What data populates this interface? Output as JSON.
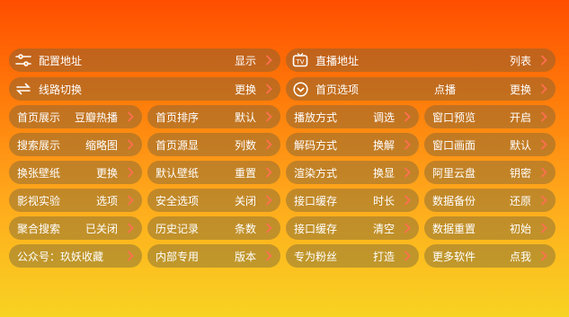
{
  "top_rows": {
    "config_address": {
      "label": "配置地址",
      "value": "显示"
    },
    "live_address": {
      "label": "直播地址",
      "value": "列表"
    },
    "route_switch": {
      "label": "线路切换",
      "value": "更换"
    },
    "home_options": {
      "label": "首页选项",
      "center": "点播",
      "value": "更换"
    }
  },
  "grid": [
    [
      {
        "label": "首页展示",
        "value": "豆瓣热播"
      },
      {
        "label": "首页排序",
        "value": "默认"
      },
      {
        "label": "播放方式",
        "value": "调选"
      },
      {
        "label": "窗口预览",
        "value": "开启"
      }
    ],
    [
      {
        "label": "搜索展示",
        "value": "缩略图"
      },
      {
        "label": "首页源显",
        "value": "列数"
      },
      {
        "label": "解码方式",
        "value": "换解"
      },
      {
        "label": "窗口画面",
        "value": "默认"
      }
    ],
    [
      {
        "label": "换张壁纸",
        "value": "更换"
      },
      {
        "label": "默认壁纸",
        "value": "重置"
      },
      {
        "label": "渲染方式",
        "value": "换显"
      },
      {
        "label": "阿里云盘",
        "value": "钥密"
      }
    ],
    [
      {
        "label": "影视实验",
        "value": "选项"
      },
      {
        "label": "安全选项",
        "value": "关闭"
      },
      {
        "label": "接口缓存",
        "value": "时长"
      },
      {
        "label": "数据备份",
        "value": "还原"
      }
    ],
    [
      {
        "label": "聚合搜索",
        "value": "已关闭"
      },
      {
        "label": "历史记录",
        "value": "条数"
      },
      {
        "label": "接口缓存",
        "value": "清空"
      },
      {
        "label": "数据重置",
        "value": "初始"
      }
    ],
    [
      {
        "label": "公众号：玖妖收藏",
        "value": ""
      },
      {
        "label": "内部专用",
        "value": "版本"
      },
      {
        "label": "专为粉丝",
        "value": "打造"
      },
      {
        "label": "更多软件",
        "value": "点我"
      }
    ]
  ],
  "icons": {
    "config": "sliders-icon",
    "live": "tv-icon",
    "route": "swap-icon",
    "home": "chevron-down-circle-icon",
    "chevron": "chevron-right-icon"
  },
  "colors": {
    "bg_top": "#ff4e00",
    "bg_bottom": "#f8d322",
    "chevron": "#ff6f50"
  }
}
